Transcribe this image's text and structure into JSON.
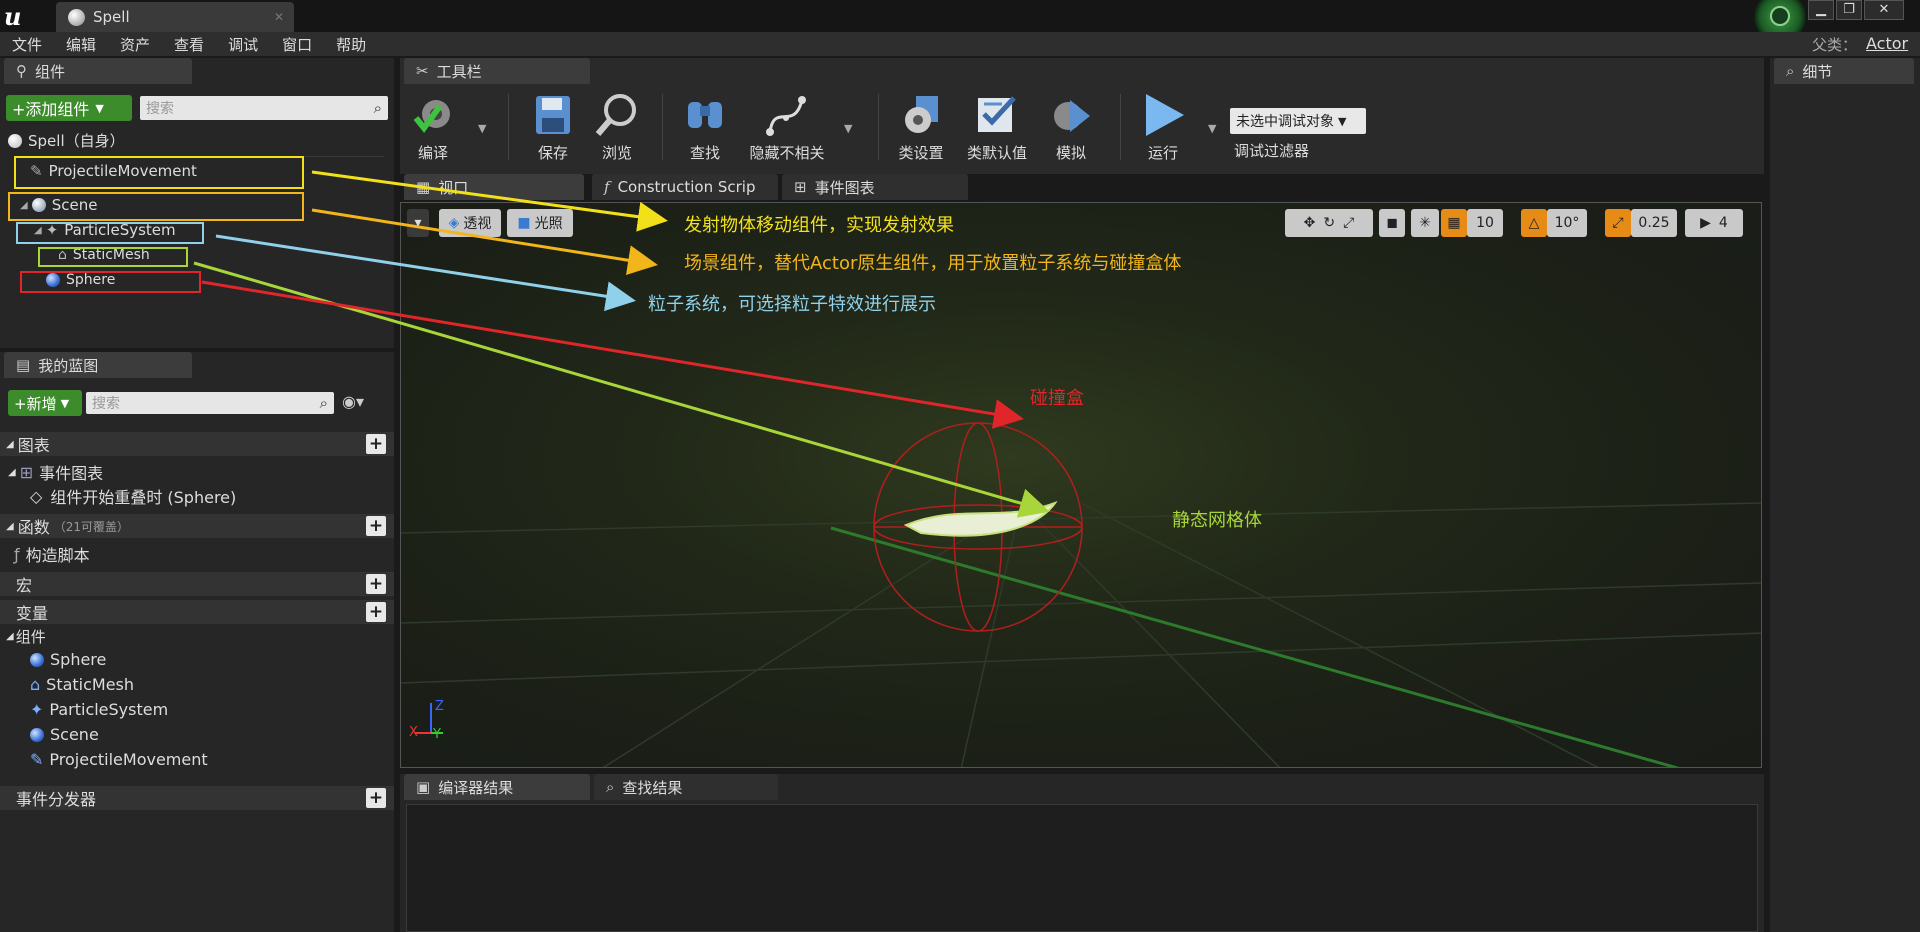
{
  "window": {
    "tab_title": "Spell",
    "parent_label": "父类：",
    "parent_value": "Actor"
  },
  "menu": [
    "文件",
    "编辑",
    "资产",
    "查看",
    "调试",
    "窗口",
    "帮助"
  ],
  "components_panel": {
    "title": "组件",
    "add_button": "+添加组件",
    "search_placeholder": "搜索",
    "root": "Spell（自身）",
    "items": [
      "ProjectileMovement",
      "Scene",
      "ParticleSystem",
      "StaticMesh",
      "Sphere"
    ]
  },
  "blueprint_panel": {
    "title": "我的蓝图",
    "new_button": "+新增",
    "search_placeholder": "搜索",
    "graphs_header": "图表",
    "event_graph": "事件图表",
    "event_item": "组件开始重叠时 (Sphere)",
    "functions_header": "函数",
    "functions_note": "（21可覆盖）",
    "construction_script": "构造脚本",
    "macros_header": "宏",
    "variables_header": "变量",
    "components_header": "组件",
    "component_vars": [
      "Sphere",
      "StaticMesh",
      "ParticleSystem",
      "Scene",
      "ProjectileMovement"
    ],
    "dispatchers_header": "事件分发器"
  },
  "toolbar": {
    "title": "工具栏",
    "buttons": [
      "编译",
      "保存",
      "浏览",
      "查找",
      "隐藏不相关",
      "类设置",
      "类默认值",
      "模拟",
      "运行"
    ],
    "debug_select": "未选中调试对象",
    "debug_filter": "调试过滤器"
  },
  "editor_tabs": [
    "视口",
    "Construction Scrip",
    "事件图表"
  ],
  "viewport": {
    "perspective": "透视",
    "lighting": "光照",
    "grid_snap": "10",
    "rotation_snap": "10°",
    "scale_snap": "0.25",
    "camera_speed": "4",
    "axis_x": "X",
    "axis_y": "Y",
    "axis_z": "Z"
  },
  "annotations": [
    "发射物体移动组件，实现发射效果",
    "场景组件，替代Actor原生组件，用于放置粒子系统与碰撞盒体",
    "粒子系统，可选择粒子特效进行展示",
    "碰撞盒",
    "静态网格体"
  ],
  "bottom_tabs": [
    "编译器结果",
    "查找结果"
  ],
  "details_panel": {
    "title": "细节"
  },
  "colors": {
    "accent_green": "#3d8c2c",
    "yellow": "#f2e11a",
    "orange": "#f2b51a",
    "light_blue": "#8fd0ea",
    "lime": "#a8d63a",
    "red": "#e0262b"
  }
}
